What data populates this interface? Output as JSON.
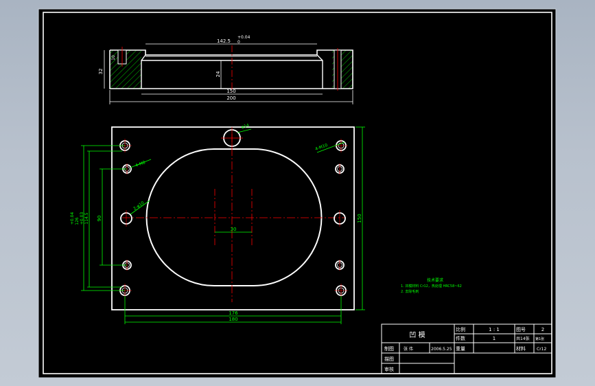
{
  "colors": {
    "background": "#000000",
    "outline": "#ffffff",
    "dimension": "#00ff00",
    "centerline": "#ff0000",
    "hatch": "#00ff00",
    "title_text": "#ffffff",
    "frame_bg": "#b8c1cd"
  },
  "top_view": {
    "dims": {
      "width_total": "200",
      "inner_width": "150",
      "slot_width": "142.5",
      "slot_tol_upper": "+0.04",
      "slot_tol_lower": "0",
      "height_total": "32",
      "depth": "24",
      "small": "10"
    }
  },
  "plan_view": {
    "dims": {
      "hole_center_span": "176",
      "outer_span": "180",
      "height": "150",
      "cavity_center": "30",
      "v1": "90",
      "v2": "114.5",
      "v2_tol": "+0.03",
      "v3": "126",
      "v3_tol": "+0.04"
    },
    "callouts": {
      "top_hole": "φ14",
      "tr_hole": "4-M10",
      "left_upper": "4-M8",
      "left_mid": "2-φ10"
    }
  },
  "notes": {
    "heading": "技术要求",
    "line1": "1. 凹模材料 Cr12，热处理 HRC58~62",
    "line2": "2. 去除毛刺"
  },
  "title_block": {
    "part_name": "凹 模",
    "scale_label": "比例",
    "scale_value": "1 : 1",
    "drawing_no_label": "图号",
    "drawing_no_value": "2",
    "qty_label": "件数",
    "qty_value": "1",
    "sheets_label": "共14张",
    "sheet_label": "第1张",
    "drawn_label": "制图",
    "drawn_name": "张 伟",
    "date": "2006.5.25",
    "weight_label": "重量",
    "material_label": "材料",
    "material_value": "Cr12",
    "checked_label": "描图",
    "approved_label": "审核"
  }
}
